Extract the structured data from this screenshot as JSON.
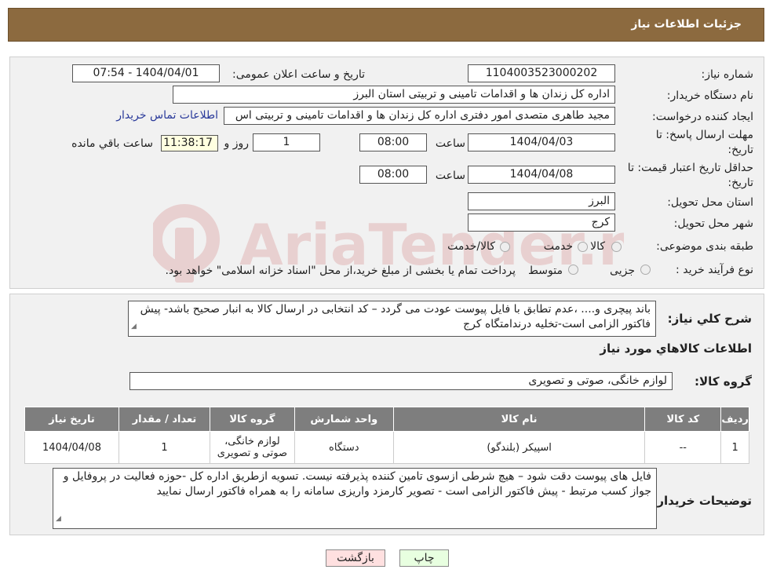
{
  "header": {
    "title": "جزئیات اطلاعات نیاز"
  },
  "info": {
    "need_number_label": "شماره نیاز:",
    "need_number": "1104003523000202",
    "announce_label": "تاریخ و ساعت اعلان عمومی:",
    "announce_value": "1404/04/01 - 07:54",
    "buyer_org_label": "نام دستگاه خریدار:",
    "buyer_org": "اداره کل زندان ها و اقدامات تامینی و تربیتی استان البرز",
    "requester_label": "ایجاد کننده درخواست:",
    "requester": "مجید طاهری متصدی امور دفتری اداره کل زندان ها و اقدامات تامینی و تربیتی اس",
    "contact_link": "اطلاعات تماس خریدار",
    "reply_deadline_label1": "مهلت ارسال پاسخ: تا",
    "reply_deadline_label2": "تاریخ:",
    "reply_date": "1404/04/03",
    "time_label": "ساعت",
    "reply_time": "08:00",
    "days": "1",
    "days_label": "روز و",
    "remaining": "11:38:17",
    "remaining_label": "ساعت باقي مانده",
    "price_valid_label1": "حداقل تاریخ اعتبار قیمت: تا",
    "price_valid_label2": "تاریخ:",
    "price_date": "1404/04/08",
    "price_time": "08:00",
    "province_label": "استان محل تحویل:",
    "province": "البرز",
    "city_label": "شهر محل تحویل:",
    "city": "کرج",
    "category_label": "طبقه بندی موضوعی:",
    "category_options": [
      "کالا",
      "خدمت",
      "کالا/خدمت"
    ],
    "process_label": "نوع فرآیند خرید :",
    "process_options": [
      "جزیی",
      "متوسط"
    ],
    "process_note": "پرداخت تمام یا بخشی از مبلغ خرید،از محل \"اسناد خزانه اسلامی\" خواهد بود."
  },
  "summary": {
    "label": "شرح كلي نياز:",
    "text": "باند پیچری و.... ،عدم تطابق با فایل پیوست عودت می گردد – کد انتخابی در ارسال کالا به انبار صحیح باشد- پیش فاکتور الزامی است-تخلیه درندامتگاه کرج"
  },
  "goods": {
    "section_title": "اطلاعات كالاهاي مورد نياز",
    "group_label": "گروه كالا:",
    "group_value": "لوازم خانگی، صوتی و تصویری",
    "columns": [
      "ردیف",
      "کد کالا",
      "نام کالا",
      "واحد شمارش",
      "گروه کالا",
      "تعداد / مقدار",
      "تاریخ نیاز"
    ],
    "rows": [
      [
        "1",
        "--",
        "اسپیکر (بلندگو)",
        "دستگاه",
        "لوازم خانگی، صوتی و تصویری",
        "1",
        "1404/04/08"
      ]
    ]
  },
  "buyer_notes": {
    "label": "توضیحات خریدار:",
    "text": "فایل های پیوست دقت شود – هیچ شرطی ازسوی تامین کننده پذیرفته نیست. تسویه ازطریق اداره کل -حوزه فعالیت در پروفایل و جواز کسب مرتبط - پیش فاکتور الزامی است - تصویر کارمزد واریزی سامانه را به همراه فاکتور ارسال نمایید"
  },
  "buttons": {
    "print": "چاپ",
    "back": "بازگشت"
  },
  "watermark": {
    "text": "AriaTender.neT"
  },
  "colors": {
    "header": "#8c6a3f",
    "table_header": "#7e7e7e",
    "link": "#2a3a9a",
    "back_button": "#ffe0e0",
    "print_button": "#e8ffe0"
  }
}
